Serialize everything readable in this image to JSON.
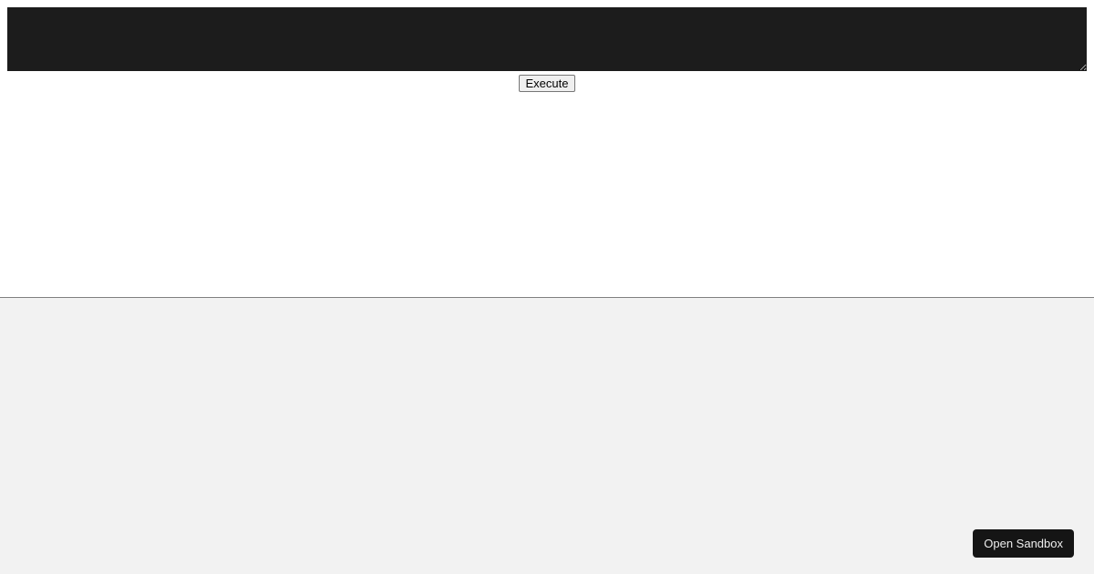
{
  "editor": {
    "code_value": ""
  },
  "buttons": {
    "execute_label": "Execute",
    "sandbox_label": "Open Sandbox"
  }
}
